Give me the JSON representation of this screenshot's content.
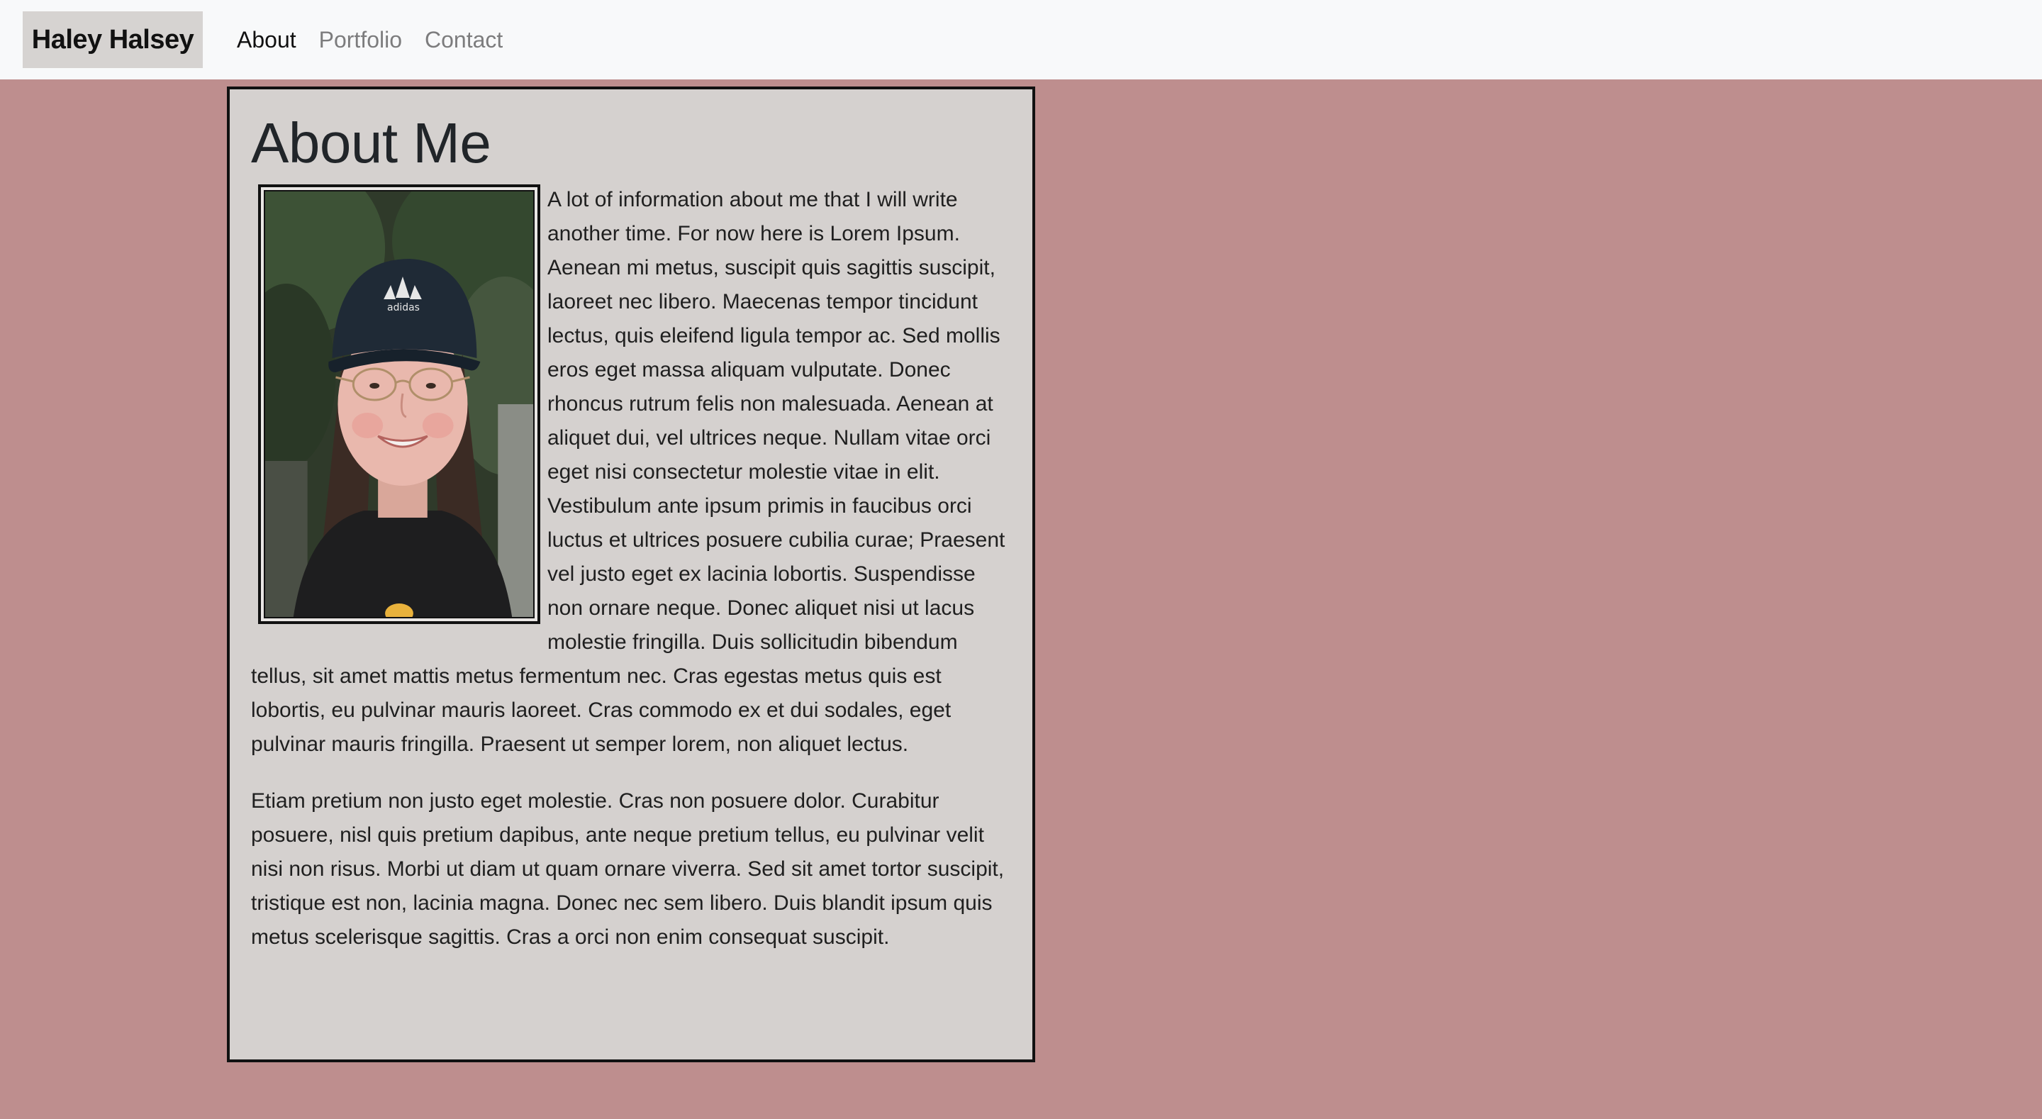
{
  "nav": {
    "brand": "Haley Halsey",
    "links": [
      {
        "label": "About",
        "active": true
      },
      {
        "label": "Portfolio",
        "active": false
      },
      {
        "label": "Contact",
        "active": false
      }
    ]
  },
  "about": {
    "title": "About Me",
    "paragraphs": [
      "A lot of information about me that I will write another time. For now here is Lorem Ipsum. Aenean mi metus, suscipit quis sagittis suscipit, laoreet nec libero. Maecenas tempor tincidunt lectus, quis eleifend ligula tempor ac. Sed mollis eros eget massa aliquam vulputate. Donec rhoncus rutrum felis non malesuada. Aenean at aliquet dui, vel ultrices neque. Nullam vitae orci eget nisi consectetur molestie vitae in elit. Vestibulum ante ipsum primis in faucibus orci luctus et ultrices posuere cubilia curae; Praesent vel justo eget ex lacinia lobortis. Suspendisse non ornare neque. Donec aliquet nisi ut lacus molestie fringilla. Duis sollicitudin bibendum tellus, sit amet mattis metus fermentum nec. Cras egestas metus quis est lobortis, eu pulvinar mauris laoreet. Cras commodo ex et dui sodales, eget pulvinar mauris fringilla. Praesent ut semper lorem, non aliquet lectus.",
      "Etiam pretium non justo eget molestie. Cras non posuere dolor. Curabitur posuere, nisl quis pretium dapibus, ante neque pretium tellus, eu pulvinar velit nisi non risus. Morbi ut diam ut quam ornare viverra. Sed sit amet tortor suscipit, tristique est non, lacinia magna. Donec nec sem libero. Duis blandit ipsum quis metus scelerisque sagittis. Cras a orci non enim consequat suscipit."
    ],
    "photo_cap_logo": "adidas"
  },
  "colors": {
    "page_background": "#be8e8e",
    "navbar_background": "#f8f9fa",
    "brand_background": "#d6d3d1",
    "card_background": "#d5d1cf",
    "border": "#111111"
  }
}
